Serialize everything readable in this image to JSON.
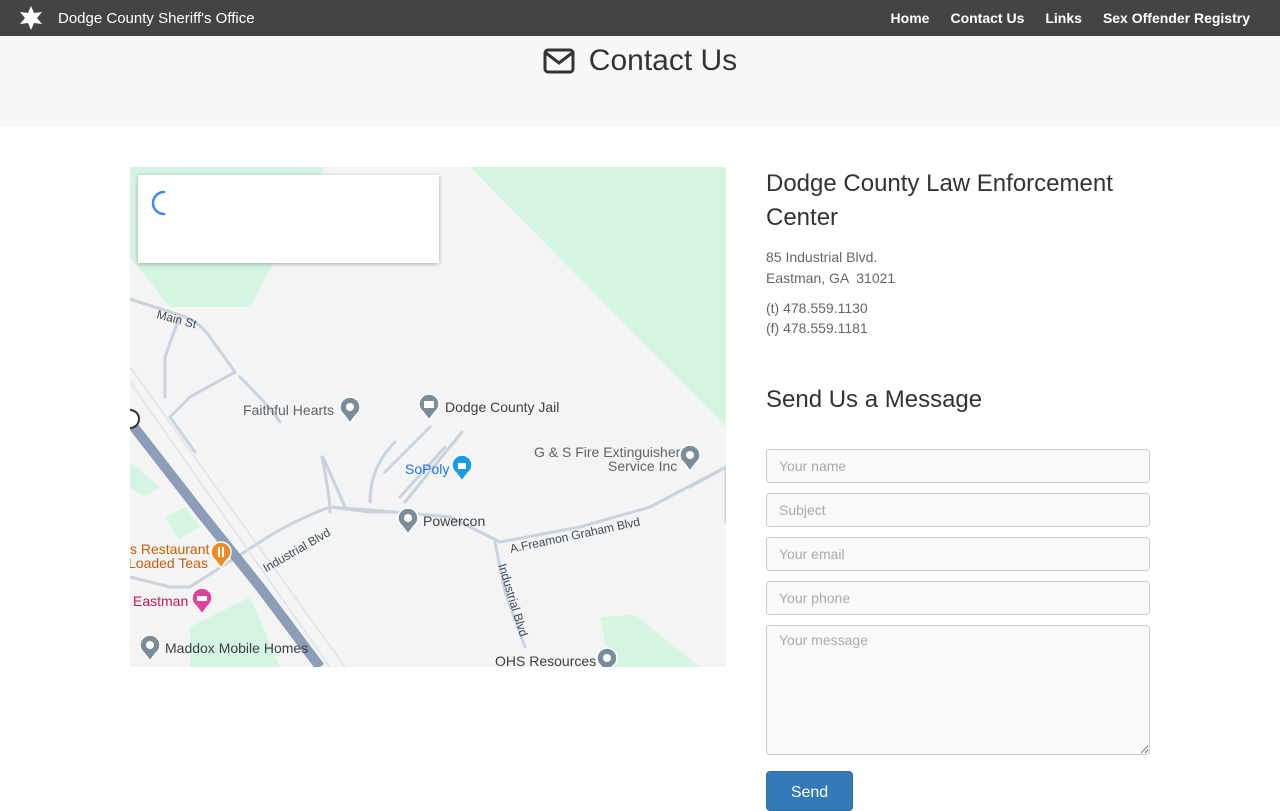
{
  "site": {
    "title": "Dodge County Sheriff's Office"
  },
  "nav": {
    "items": [
      {
        "label": "Home"
      },
      {
        "label": "Contact Us"
      },
      {
        "label": "Links"
      },
      {
        "label": "Sex Offender Registry"
      }
    ]
  },
  "hero": {
    "title": "Contact Us",
    "icon": "envelope-icon"
  },
  "map": {
    "places": {
      "faithful_hearts": "Faithful Hearts",
      "dodge_county_jail": "Dodge County Jail",
      "gs_fire_line1": "G & S Fire Extinguisher",
      "gs_fire_line2": "Service Inc",
      "sopoly": "SoPoly",
      "powercon": "Powercon",
      "restaurant_line1": "s Restaurant",
      "restaurant_line2": "Loaded Teas",
      "eastman": "Eastman",
      "maddox": "Maddox Mobile Homes",
      "ohs": "OHS Resources"
    },
    "streets": {
      "main_st": "Main St",
      "industrial_blvd_1": "Industrial Blvd",
      "industrial_blvd_2": "Industrial Blvd",
      "freamon": "A.Freamon Graham Blvd"
    },
    "colors": {
      "land": "#f4f4f4",
      "park": "#d3f5e1",
      "road": "#c9d3de",
      "highway": "#8b9db7"
    }
  },
  "location": {
    "name": "Dodge County Law Enforcement Center",
    "address_line1": "85 Industrial Blvd.",
    "address_line2": "Eastman, GA  31021",
    "phone": "(t) 478.559.1130",
    "fax": "(f) 478.559.1181"
  },
  "form": {
    "title": "Send Us a Message",
    "name_placeholder": "Your name",
    "subject_placeholder": "Subject",
    "email_placeholder": "Your email",
    "phone_placeholder": "Your phone",
    "message_placeholder": "Your message",
    "send_label": "Send"
  },
  "colors": {
    "topbar": "#444444",
    "hero_bg": "#f8f8f8",
    "button": "#337ab7"
  }
}
